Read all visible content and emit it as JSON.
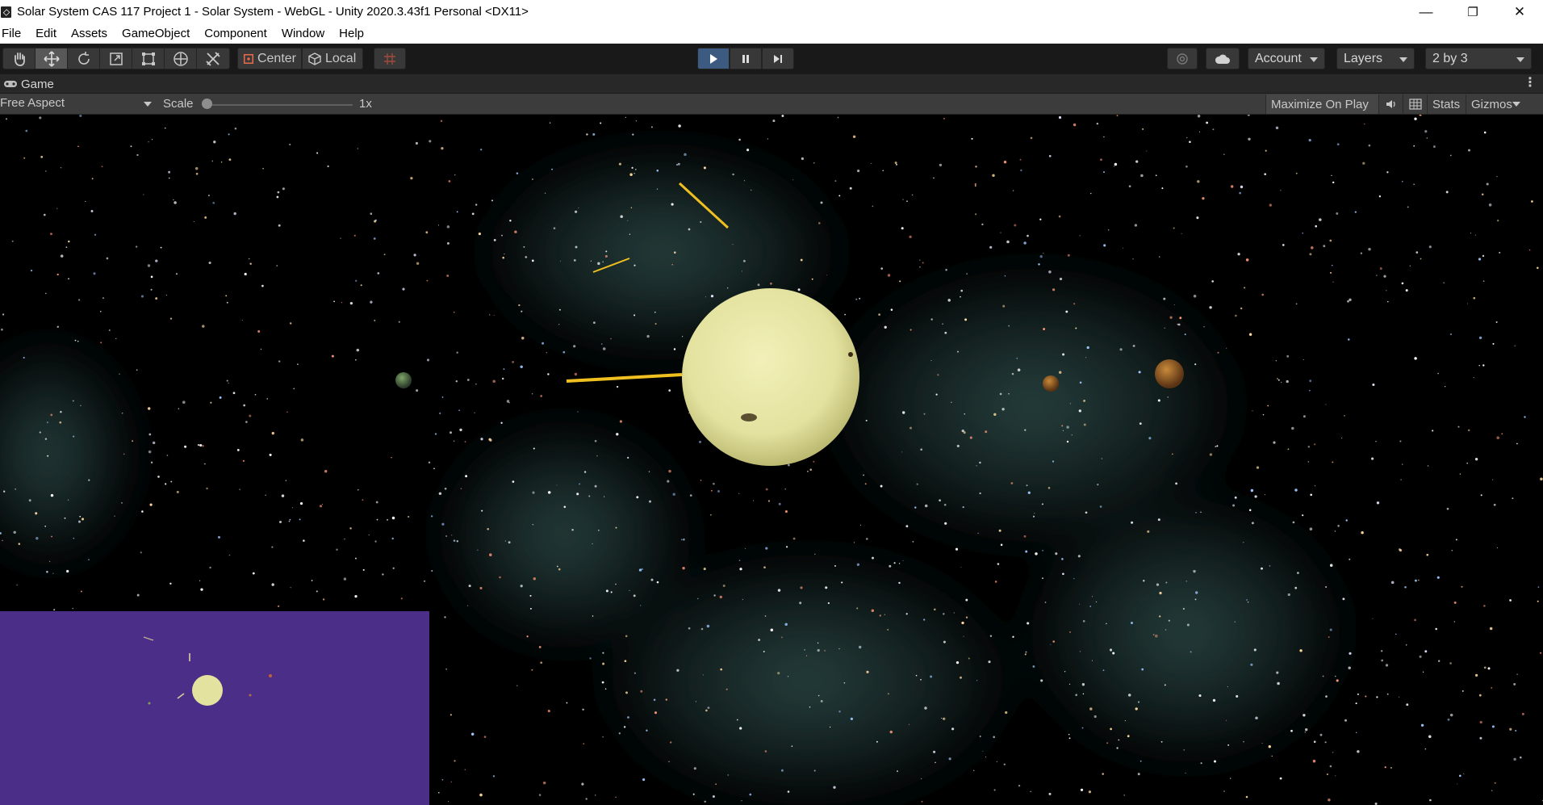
{
  "window": {
    "title": "Solar System CAS 117 Project 1 - Solar System - WebGL - Unity 2020.3.43f1 Personal <DX11>",
    "minimize_glyph": "—",
    "restore_glyph": "❐",
    "close_glyph": "✕"
  },
  "menubar": {
    "items": [
      "File",
      "Edit",
      "Assets",
      "GameObject",
      "Component",
      "Window",
      "Help"
    ]
  },
  "toolbar": {
    "tools": [
      "hand-tool-icon",
      "move-tool-icon",
      "rotate-tool-icon",
      "scale-tool-icon",
      "rect-tool-icon",
      "transform-tool-icon",
      "custom-tool-icon"
    ],
    "pivot_mode": "Center",
    "pivot_rotation": "Local",
    "grid_snap_icon": "grid-snap-icon",
    "play_state": "playing",
    "account_label": "Account",
    "layers_label": "Layers",
    "layout_label": "2 by 3",
    "accent_play": "#3d5a80"
  },
  "game_tab": {
    "label": "Game",
    "icon": "gamepad-icon",
    "menu_glyph": "⋮"
  },
  "game_toolbar": {
    "aspect": "Free Aspect",
    "scale_label": "Scale",
    "scale_value_text": "1x",
    "scale_fraction": 0.0,
    "maximize_label": "Maximize On Play",
    "stats_label": "Stats",
    "gizmos_label": "Gizmos"
  },
  "scene": {
    "sky_color": "#000000",
    "nebula_color": "#4a7b78",
    "sun_color": "#e3e29f",
    "minimap_color": "#4b2e87"
  }
}
